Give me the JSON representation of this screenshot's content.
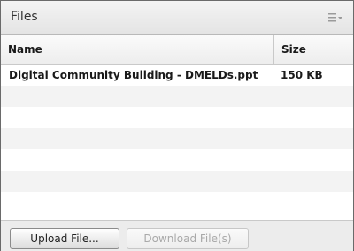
{
  "pod": {
    "title": "Files",
    "menu_icon": "list-menu-icon"
  },
  "table": {
    "columns": [
      "Name",
      "Size"
    ],
    "rows": [
      {
        "name": "Digital Community Building - DMELDs.ppt",
        "size": "150 KB"
      }
    ]
  },
  "footer": {
    "upload_label": "Upload File...",
    "download_label": "Download File(s)",
    "download_enabled": false
  },
  "colors": {
    "border": "#6a6a6a",
    "alt_row": "#f3f3f3",
    "disabled_text": "#a9a9a9"
  }
}
